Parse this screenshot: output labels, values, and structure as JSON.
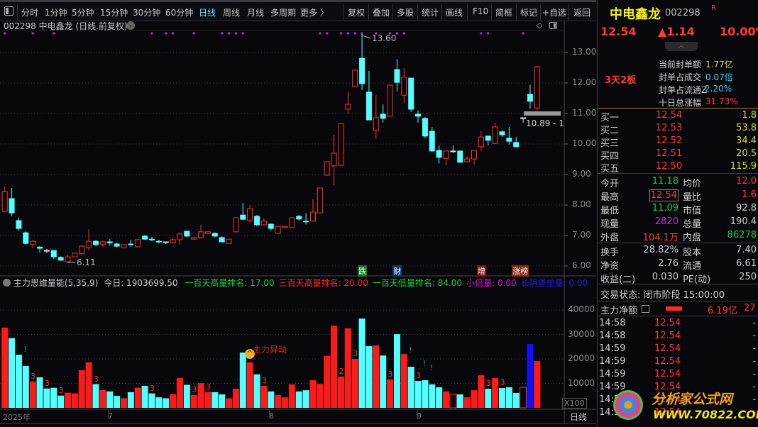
{
  "toolbar": {
    "period_items": [
      "分时",
      "1分钟",
      "5分钟",
      "15分钟",
      "30分钟",
      "60分钟",
      "日线",
      "周线",
      "月线",
      "多周期",
      "更多 〉"
    ],
    "active_period": "日线",
    "action_items": [
      "复权",
      "叠加",
      "多股",
      "统计",
      "画线",
      "F10",
      "简框",
      "标记",
      "+自选",
      "返回"
    ]
  },
  "chart_header": "002298 中电鑫龙 (日线.前复权)",
  "price_axis": [
    "13.00",
    "12.00",
    "11.00",
    "10.00",
    "9.00",
    "8.00",
    "7.00",
    "6.00"
  ],
  "volume_axis": [
    "40000",
    "30000",
    "20000",
    "10000"
  ],
  "volume_unit": "X100",
  "period_label": "日线",
  "date_axis": [
    "2025年",
    "7",
    "8",
    "9"
  ],
  "annotations": {
    "high": "13.60",
    "low": "6.11",
    "last_range": "10.89 - 1",
    "main_force": "主力异动"
  },
  "event_tags": [
    {
      "label": "跌",
      "bg": "#0f7a1e",
      "candle": 51
    },
    {
      "label": "财",
      "bg": "#103a6e",
      "candle": 56
    },
    {
      "label": "增",
      "bg": "#8a1010",
      "candle": 68
    },
    {
      "label": "涨榜",
      "bg": "#8a2a10",
      "candle": 73
    }
  ],
  "indicator": {
    "name": "主力思维量能(5,35,9)",
    "today": "今日: 1903699.50",
    "items": [
      {
        "text": "一百天高量排名: 17.00",
        "color": "#22d040"
      },
      {
        "text": "三百天高量排名: 20.00",
        "color": "#ff2a2a"
      },
      {
        "text": "一百天低量排名: 84.00",
        "color": "#22d040"
      },
      {
        "text": "小倍量: 0.00",
        "color": "#d020d0"
      },
      {
        "text": "长阴堡垒量: 0.00",
        "color": "#2020e0"
      }
    ]
  },
  "chart_data": {
    "type": "candlestick",
    "ylim": [
      5.75,
      13.75
    ],
    "ohlc": [
      [
        7.79,
        8.6,
        7.79,
        8.44
      ],
      [
        8.21,
        8.56,
        7.63,
        7.74
      ],
      [
        7.49,
        7.59,
        7.16,
        7.23
      ],
      [
        7.09,
        7.14,
        6.7,
        6.74
      ],
      [
        6.7,
        6.86,
        6.58,
        6.81
      ],
      [
        6.62,
        6.65,
        6.44,
        6.58
      ],
      [
        6.51,
        6.56,
        6.42,
        6.51
      ],
      [
        6.51,
        6.51,
        6.23,
        6.3
      ],
      [
        6.28,
        6.32,
        6.17,
        6.19
      ],
      [
        6.14,
        6.37,
        6.11,
        6.3
      ],
      [
        6.3,
        6.42,
        6.3,
        6.42
      ],
      [
        6.4,
        6.7,
        6.35,
        6.65
      ],
      [
        6.6,
        7.21,
        6.51,
        6.81
      ],
      [
        6.81,
        6.86,
        6.65,
        6.7
      ],
      [
        6.7,
        6.84,
        6.63,
        6.79
      ],
      [
        6.79,
        6.88,
        6.67,
        6.76
      ],
      [
        6.72,
        6.77,
        6.6,
        6.65
      ],
      [
        6.6,
        6.7,
        6.58,
        6.7
      ],
      [
        6.72,
        6.86,
        6.63,
        6.7
      ],
      [
        6.63,
        6.88,
        6.6,
        6.86
      ],
      [
        6.98,
        7.02,
        6.86,
        6.88
      ],
      [
        6.88,
        6.95,
        6.81,
        6.86
      ],
      [
        6.81,
        6.86,
        6.74,
        6.79
      ],
      [
        6.79,
        6.79,
        6.72,
        6.79
      ],
      [
        6.77,
        6.91,
        6.74,
        6.86
      ],
      [
        6.86,
        7.09,
        6.7,
        7.05
      ],
      [
        7.14,
        7.16,
        6.95,
        6.98
      ],
      [
        6.88,
        6.95,
        6.86,
        6.93
      ],
      [
        6.93,
        7.35,
        6.91,
        7.12
      ],
      [
        7.07,
        7.14,
        7.05,
        7.12
      ],
      [
        7.07,
        7.1,
        6.95,
        6.98
      ],
      [
        6.93,
        6.98,
        6.79,
        6.79
      ],
      [
        6.74,
        6.88,
        6.72,
        6.88
      ],
      [
        7.12,
        7.58,
        7.1,
        7.58
      ],
      [
        7.67,
        8.07,
        7.53,
        7.53
      ],
      [
        7.49,
        8.0,
        7.4,
        7.88
      ],
      [
        7.63,
        7.67,
        7.3,
        7.35
      ],
      [
        7.35,
        7.58,
        7.33,
        7.47
      ],
      [
        7.37,
        7.4,
        7.16,
        7.23
      ],
      [
        7.07,
        7.3,
        7.05,
        7.3
      ],
      [
        7.26,
        7.3,
        7.26,
        7.3
      ],
      [
        7.26,
        7.58,
        7.26,
        7.58
      ],
      [
        7.63,
        7.67,
        7.49,
        7.54
      ],
      [
        7.47,
        7.74,
        7.36,
        7.46
      ],
      [
        7.47,
        8.19,
        7.45,
        7.77
      ],
      [
        7.74,
        8.56,
        7.74,
        8.56
      ],
      [
        8.98,
        9.42,
        8.95,
        9.42
      ],
      [
        9.28,
        10.3,
        8.65,
        9.7
      ],
      [
        9.3,
        10.67,
        9.3,
        10.67
      ],
      [
        11.14,
        11.72,
        10.98,
        11.3
      ],
      [
        11.88,
        12.42,
        11.88,
        12.42
      ],
      [
        12.81,
        13.6,
        11.77,
        11.98
      ],
      [
        11.7,
        12.4,
        10.79,
        10.79
      ],
      [
        10.44,
        11.6,
        10.16,
        10.86
      ],
      [
        10.98,
        11.3,
        10.7,
        10.84
      ],
      [
        10.91,
        11.93,
        10.91,
        11.93
      ],
      [
        12.44,
        12.79,
        11.72,
        12.02
      ],
      [
        11.6,
        12.49,
        11.35,
        12.19
      ],
      [
        12.16,
        12.16,
        11.05,
        11.14
      ],
      [
        10.98,
        11.1,
        10.7,
        10.91
      ],
      [
        10.84,
        10.88,
        10.19,
        10.26
      ],
      [
        10.42,
        10.56,
        9.75,
        9.77
      ],
      [
        9.79,
        9.95,
        9.36,
        9.56
      ],
      [
        9.53,
        9.77,
        9.3,
        9.77
      ],
      [
        9.77,
        9.95,
        9.7,
        9.77
      ],
      [
        9.77,
        9.79,
        9.4,
        9.4
      ],
      [
        9.42,
        9.6,
        9.4,
        9.51
      ],
      [
        9.51,
        9.79,
        9.33,
        9.79
      ],
      [
        9.91,
        10.42,
        9.77,
        10.23
      ],
      [
        10.26,
        10.26,
        9.95,
        10.12
      ],
      [
        10.02,
        10.7,
        10.0,
        10.56
      ],
      [
        10.4,
        10.45,
        10.23,
        10.3
      ],
      [
        10.19,
        10.56,
        9.98,
        10.09
      ],
      [
        10.05,
        10.23,
        9.91,
        9.91
      ],
      [
        10.86,
        10.86,
        10.7,
        10.86
      ],
      [
        11.63,
        11.95,
        11.16,
        11.4
      ],
      [
        11.18,
        12.54,
        11.09,
        12.54
      ]
    ],
    "volume_x100_thousands": [
      32.8,
      28.5,
      21.7,
      17.1,
      10.8,
      12.5,
      7.9,
      8.2,
      5.0,
      6.2,
      5.9,
      15.4,
      18.6,
      9.7,
      7.3,
      6.7,
      4.9,
      3.9,
      6.4,
      8.2,
      9.0,
      5.9,
      4.3,
      3.9,
      5.6,
      12.2,
      9.4,
      5.2,
      10.1,
      6.5,
      6.4,
      5.5,
      3.9,
      7.8,
      22.6,
      18.6,
      13.7,
      9.0,
      6.7,
      5.2,
      4.3,
      9.6,
      6.7,
      7.2,
      11.3,
      9.8,
      21.2,
      33.6,
      12.8,
      32.5,
      20.0,
      36.5,
      25.2,
      25.5,
      21.4,
      11.6,
      30.1,
      22.0,
      16.8,
      11.0,
      11.3,
      9.6,
      8.4,
      6.7,
      5.5,
      5.5,
      4.3,
      7.2,
      13.3,
      7.8,
      12.2,
      8.1,
      8.4,
      6.1,
      8.4,
      26.1,
      19.1
    ],
    "volume_colors": [
      "r",
      "c",
      "c",
      "c",
      "r",
      "c",
      "c",
      "c",
      "c",
      "r",
      "r",
      "r",
      "r",
      "c",
      "r",
      "c",
      "c",
      "r",
      "c",
      "r",
      "c",
      "c",
      "c",
      "c",
      "r",
      "r",
      "c",
      "r",
      "r",
      "r",
      "c",
      "c",
      "r",
      "r",
      "c",
      "r",
      "c",
      "r",
      "c",
      "r",
      "r",
      "r",
      "c",
      "c",
      "r",
      "r",
      "r",
      "r",
      "r",
      "r",
      "r",
      "c",
      "c",
      "r",
      "c",
      "r",
      "c",
      "r",
      "c",
      "c",
      "c",
      "c",
      "c",
      "r",
      "h",
      "c",
      "r",
      "r",
      "r",
      "c",
      "r",
      "c",
      "c",
      "c",
      "h",
      "b",
      "r"
    ],
    "volume_ylim": [
      0,
      45
    ],
    "signal_dots": [
      0,
      4,
      7,
      21,
      23,
      24,
      27,
      31,
      32,
      33,
      34,
      45,
      46,
      48,
      49,
      50,
      51,
      53,
      55,
      56,
      57,
      68,
      69,
      74
    ],
    "volume_markers": [
      {
        "i": 3,
        "text": "!",
        "color": "#1a9a9a"
      },
      {
        "i": 4,
        "text": "3",
        "color": "#ff3232"
      },
      {
        "i": 6,
        "text": "3",
        "color": "#ff3232"
      },
      {
        "i": 8,
        "text": "3",
        "color": "#ff3232"
      },
      {
        "i": 13,
        "text": "3",
        "color": "#ff3232"
      },
      {
        "i": 21,
        "text": "3",
        "color": "#ff3232"
      },
      {
        "i": 27,
        "text": "3",
        "color": "#ff3232"
      },
      {
        "i": 29,
        "text": "3",
        "color": "#ff3232"
      },
      {
        "i": 37,
        "text": "3",
        "color": "#ff3232"
      },
      {
        "i": 48,
        "text": "2",
        "color": "#ff3232"
      },
      {
        "i": 50,
        "text": "3",
        "color": "#ff3232"
      },
      {
        "i": 55,
        "text": "3",
        "color": "#ff3232"
      },
      {
        "i": 58,
        "text": "!",
        "color": "#1a9a9a"
      },
      {
        "i": 59,
        "text": "3",
        "color": "#ff3232"
      },
      {
        "i": 60,
        "text": "!",
        "color": "#1a9a9a"
      },
      {
        "i": 61,
        "text": "!",
        "color": "#1a9a9a"
      },
      {
        "i": 69,
        "text": "3",
        "color": "#ff3232"
      },
      {
        "i": 71,
        "text": "3",
        "color": "#ff3232"
      }
    ]
  },
  "quote": {
    "name": "中电鑫龙",
    "code": "002298",
    "badge": "R",
    "price": "12.54",
    "change": "▲1.14",
    "change_pct": "10.00%",
    "board_tag": "3天2板",
    "seal_info": [
      {
        "label": "当前封单额",
        "value": "1.77亿",
        "cls": "yel"
      },
      {
        "label": "封单占成交",
        "value": "0.07倍",
        "cls": "cyan"
      },
      {
        "label": "封单占流通Z",
        "value": "2.20%",
        "cls": "cyan"
      },
      {
        "label": "十日总涨幅",
        "value": "31.73%",
        "cls": "red"
      }
    ],
    "bids": [
      {
        "label": "买一",
        "price": "12.54",
        "vol": "1.8"
      },
      {
        "label": "买二",
        "price": "12.53",
        "vol": "53.8"
      },
      {
        "label": "买三",
        "price": "12.52",
        "vol": "34.4"
      },
      {
        "label": "买四",
        "price": "12.51",
        "vol": "20.5"
      },
      {
        "label": "买五",
        "price": "12.50",
        "vol": "115.9"
      }
    ],
    "stats": [
      {
        "l1": "今开",
        "v1": "11.18",
        "c1": "grn",
        "l2": "均价",
        "v2": "12.0",
        "c2": "red"
      },
      {
        "l1": "最高",
        "v1": "12.54",
        "c1": "red",
        "l2": "量比",
        "v2": "1.6",
        "c2": "red"
      },
      {
        "l1": "最低",
        "v1": "11.09",
        "c1": "grn",
        "l2": "市值",
        "v2": "92.8",
        "c2": "wht"
      },
      {
        "l1": "现量",
        "v1": "2820",
        "c1": "mag",
        "l2": "总量",
        "v2": "190.4",
        "c2": "wht"
      },
      {
        "l1": "外盘",
        "v1": "104.1万",
        "c1": "red",
        "l2": "内盘",
        "v2": "86278",
        "c2": "grn"
      }
    ],
    "stats2": [
      {
        "l1": "换手",
        "v1": "28.82%",
        "l2": "股本",
        "v2": "7.40"
      },
      {
        "l1": "净资",
        "v1": "2.76",
        "l2": "流通",
        "v2": "6.61"
      },
      {
        "l1": "收益(二)",
        "v1": "0.030",
        "l2": "PE(动)",
        "v2": "250"
      }
    ],
    "trade_status": "交易状态: 闭市阶段 15:00:00",
    "main_net_label": "主力净额",
    "main_net_value": "6.19亿",
    "main_net_extra": "27",
    "ticks": [
      {
        "time": "14:58",
        "price": "12.54"
      },
      {
        "time": "14:58",
        "price": "12.54"
      },
      {
        "time": "14:59",
        "price": "12.54"
      },
      {
        "time": "14:59",
        "price": "12.54"
      },
      {
        "time": "14:59",
        "price": "12.54"
      },
      {
        "time": "14:59",
        "price": "12.54"
      },
      {
        "time": "14:59",
        "price": "12.54"
      },
      {
        "time": "14:59",
        "price": "12.54"
      }
    ]
  },
  "watermark": {
    "title": "分析家公式网",
    "url": "WWW.70822.COM"
  }
}
